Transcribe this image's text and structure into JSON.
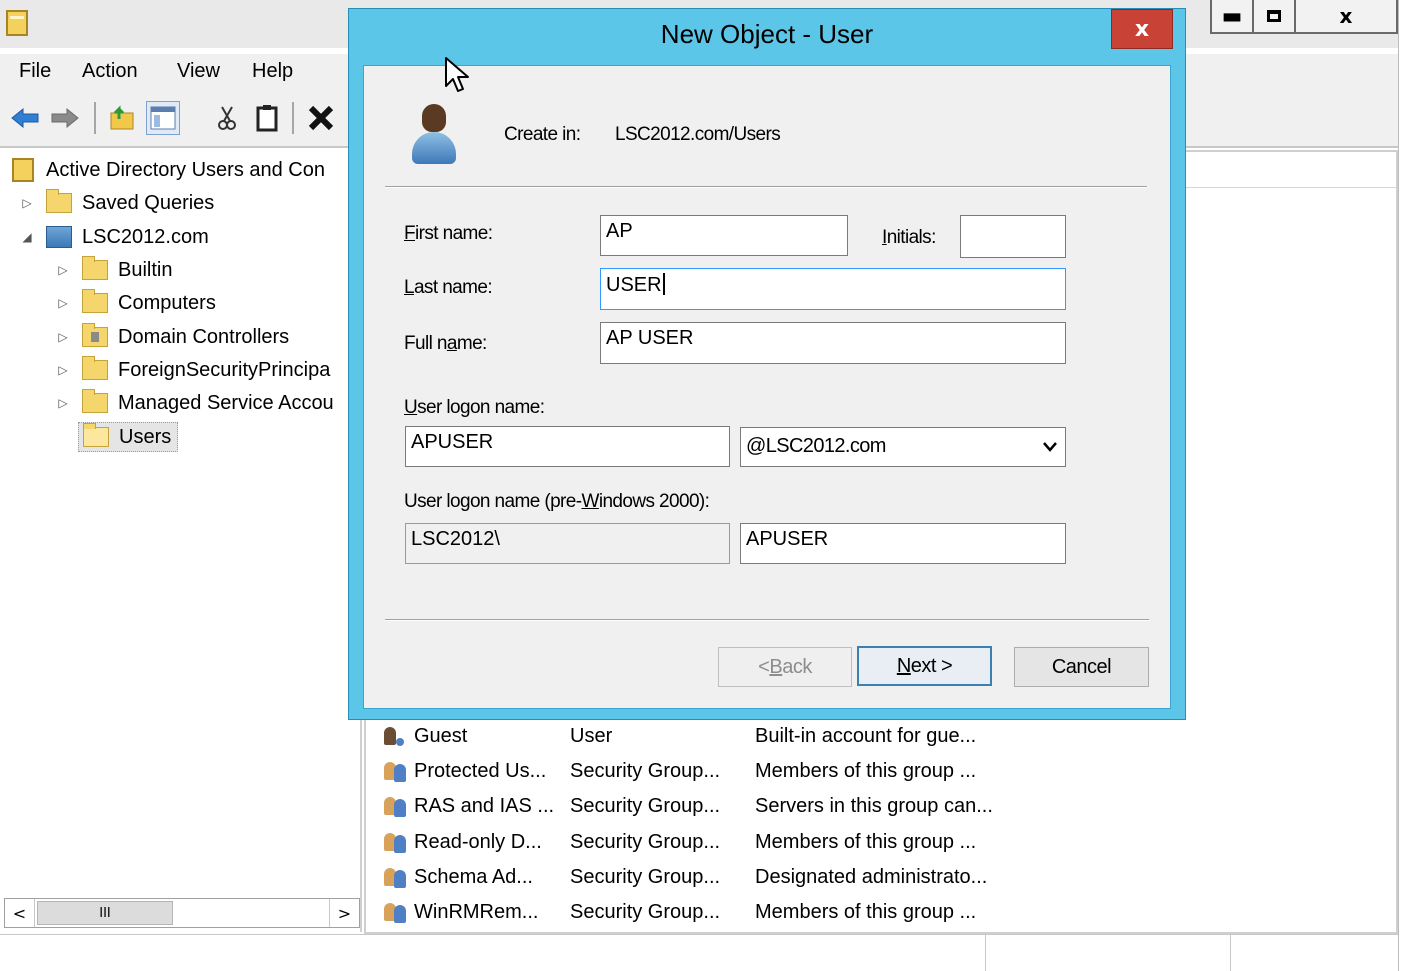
{
  "main_window": {
    "menu": [
      "File",
      "Action",
      "View",
      "Help"
    ],
    "window_controls": {
      "minimize": "▬",
      "close": "x"
    },
    "toolbar_icons": [
      "back-arrow-icon",
      "forward-arrow-icon",
      "up-folder-icon",
      "show-hide-console-tree-icon",
      "cut-icon",
      "copy-icon",
      "delete-icon"
    ],
    "tree": {
      "root": "Active Directory Users and Con",
      "saved_queries": "Saved Queries",
      "domain": "LSC2012.com",
      "children": [
        "Builtin",
        "Computers",
        "Domain Controllers",
        "ForeignSecurityPrincipa",
        "Managed Service Accou",
        "Users"
      ]
    },
    "scrollbar": {
      "left": "<",
      "thumb": "III",
      "right": ">"
    },
    "list": [
      {
        "name": "Guest",
        "type": "User",
        "description": "Built-in account for gue..."
      },
      {
        "name": "Protected Us...",
        "type": "Security Group...",
        "description": "Members of this group ..."
      },
      {
        "name": "RAS and IAS ...",
        "type": "Security Group...",
        "description": "Servers in this group can..."
      },
      {
        "name": "Read-only D...",
        "type": "Security Group...",
        "description": "Members of this group ..."
      },
      {
        "name": "Schema Ad...",
        "type": "Security Group...",
        "description": "Designated administrato..."
      },
      {
        "name": "WinRMRem...",
        "type": "Security Group...",
        "description": "Members of this group ..."
      }
    ]
  },
  "dialog": {
    "title": "New Object - User",
    "close": "x",
    "create_in_label": "Create in:",
    "create_in_path": "LSC2012.com/Users",
    "first_name": {
      "label_key": "F",
      "label_rest": "irst name:",
      "value": "AP"
    },
    "initials": {
      "label_key": "I",
      "label_rest": "nitials:",
      "value": ""
    },
    "last_name": {
      "label_key": "L",
      "label_rest": "ast name:",
      "value": "USER"
    },
    "full_name": {
      "label_pre": "Full n",
      "label_key": "a",
      "label_post": "me:",
      "value": "AP USER"
    },
    "logon_name": {
      "label_key": "U",
      "label_rest": "ser logon name:",
      "value": "APUSER",
      "domain": "@LSC2012.com"
    },
    "pre2000": {
      "label_pre": "User logon name (pre-",
      "label_key": "W",
      "label_post": "indows 2000):",
      "domain": "LSC2012\\",
      "value": "APUSER"
    },
    "buttons": {
      "back": {
        "pre": "< ",
        "key": "B",
        "post": "ack"
      },
      "next": {
        "pre": "",
        "key": "N",
        "post": "ext >"
      },
      "cancel": "Cancel"
    }
  }
}
